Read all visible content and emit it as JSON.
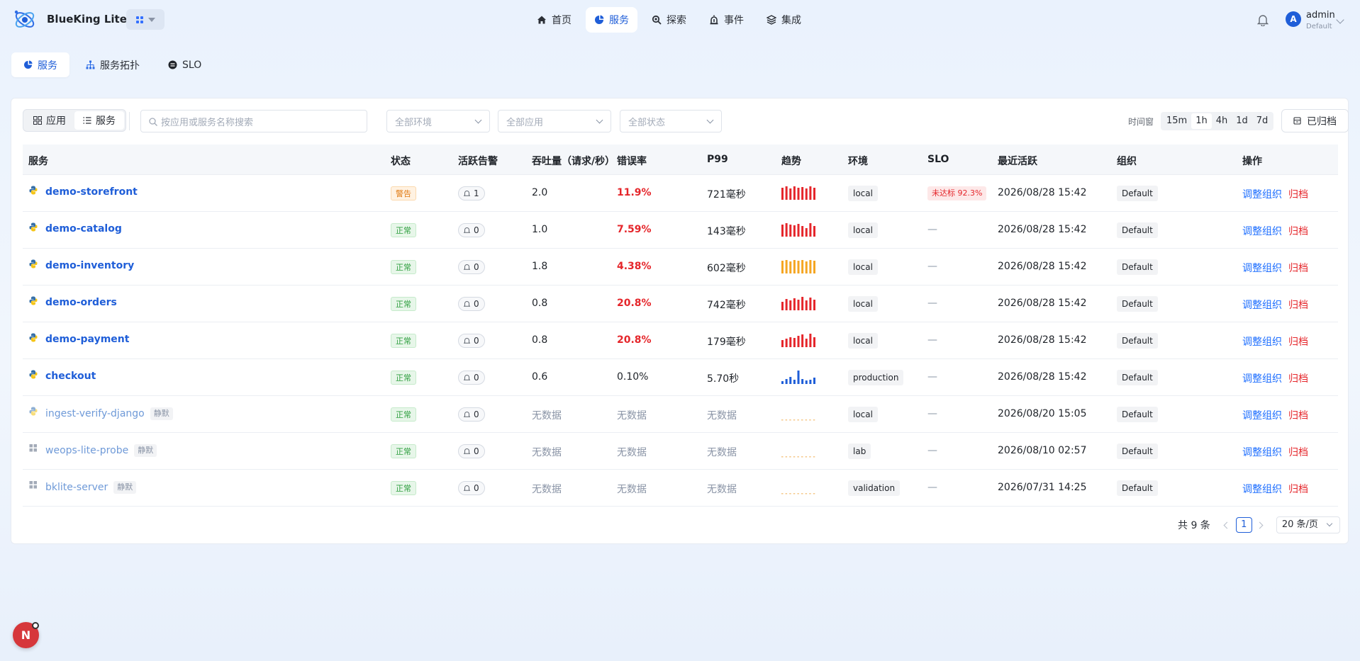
{
  "app": {
    "brand": "BlueKing Lite",
    "workspace_icon": "grid-icon"
  },
  "nav": [
    {
      "label": "首页",
      "icon": "home-icon",
      "active": false
    },
    {
      "label": "服务",
      "icon": "service-icon",
      "active": true
    },
    {
      "label": "探索",
      "icon": "explore-icon",
      "active": false
    },
    {
      "label": "事件",
      "icon": "alarm-icon",
      "active": false
    },
    {
      "label": "集成",
      "icon": "layers-icon",
      "active": false
    }
  ],
  "user": {
    "initial": "A",
    "name": "admin",
    "org": "Default"
  },
  "subtabs": [
    {
      "label": "服务",
      "active": true
    },
    {
      "label": "服务拓扑",
      "active": false
    },
    {
      "label": "SLO",
      "active": false
    }
  ],
  "toolbar": {
    "view_app": "应用",
    "view_service": "服务",
    "search_placeholder": "按应用或服务名称搜索",
    "filter_env": "全部环境",
    "filter_app": "全部应用",
    "filter_status": "全部状态",
    "time_label": "时间窗",
    "time_options": [
      "15m",
      "1h",
      "4h",
      "1d",
      "7d"
    ],
    "time_selected": "1h",
    "archived_label": "已归档"
  },
  "table": {
    "columns": {
      "service": "服务",
      "status": "状态",
      "alerts": "活跃告警",
      "throughput": "吞吐量（请求/秒）",
      "error_rate": "错误率",
      "p99": "P99",
      "trend": "趋势",
      "env": "环境",
      "slo": "SLO",
      "last_active": "最近活跃",
      "org": "组织",
      "ops": "操作"
    },
    "muted_label": "静默",
    "action_adjust": "调整组织",
    "action_archive": "归档",
    "no_slo": "—",
    "rows": [
      {
        "name": "demo-storefront",
        "lang": "python",
        "muted": false,
        "status": "警告",
        "status_type": "warn",
        "alerts": "1",
        "throughput": "2.0",
        "error_rate": "11.9%",
        "error_high": true,
        "p99": "721毫秒",
        "trend_color": "#e5262b",
        "trend": [
          0.85,
          0.95,
          0.8,
          0.95,
          0.85,
          0.9,
          0.8,
          0.95,
          0.85
        ],
        "env": "local",
        "slo": "未达标 92.3%",
        "last_active": "2026/08/28 15:42",
        "org": "Default"
      },
      {
        "name": "demo-catalog",
        "lang": "python",
        "muted": false,
        "status": "正常",
        "status_type": "ok",
        "alerts": "0",
        "throughput": "1.0",
        "error_rate": "7.59%",
        "error_high": true,
        "p99": "143毫秒",
        "trend_color": "#e5262b",
        "trend": [
          0.85,
          0.95,
          0.85,
          0.8,
          0.9,
          0.75,
          0.6,
          0.95,
          0.75
        ],
        "env": "local",
        "slo": "",
        "last_active": "2026/08/28 15:42",
        "org": "Default"
      },
      {
        "name": "demo-inventory",
        "lang": "python",
        "muted": false,
        "status": "正常",
        "status_type": "ok",
        "alerts": "0",
        "throughput": "1.8",
        "error_rate": "4.38%",
        "error_high": true,
        "p99": "602毫秒",
        "trend_color": "#f5a623",
        "trend": [
          0.9,
          0.95,
          0.85,
          0.95,
          0.9,
          0.95,
          0.85,
          0.95,
          0.9
        ],
        "env": "local",
        "slo": "",
        "last_active": "2026/08/28 15:42",
        "org": "Default"
      },
      {
        "name": "demo-orders",
        "lang": "python",
        "muted": false,
        "status": "正常",
        "status_type": "ok",
        "alerts": "0",
        "throughput": "0.8",
        "error_rate": "20.8%",
        "error_high": true,
        "p99": "742毫秒",
        "trend_color": "#e5262b",
        "trend": [
          0.6,
          0.8,
          0.7,
          0.85,
          0.75,
          0.95,
          0.7,
          0.9,
          0.75
        ],
        "env": "local",
        "slo": "",
        "last_active": "2026/08/28 15:42",
        "org": "Default"
      },
      {
        "name": "demo-payment",
        "lang": "python",
        "muted": false,
        "status": "正常",
        "status_type": "ok",
        "alerts": "0",
        "throughput": "0.8",
        "error_rate": "20.8%",
        "error_high": true,
        "p99": "179毫秒",
        "trend_color": "#e5262b",
        "trend": [
          0.5,
          0.6,
          0.7,
          0.65,
          0.8,
          0.9,
          0.6,
          0.95,
          0.7
        ],
        "env": "local",
        "slo": "",
        "last_active": "2026/08/28 15:42",
        "org": "Default"
      },
      {
        "name": "checkout",
        "lang": "python",
        "muted": false,
        "status": "正常",
        "status_type": "ok",
        "alerts": "0",
        "throughput": "0.6",
        "error_rate": "0.10%",
        "error_high": false,
        "p99": "5.70秒",
        "trend_color": "#1f5ed8",
        "trend": [
          0.2,
          0.35,
          0.5,
          0.3,
          0.95,
          0.35,
          0.25,
          0.3,
          0.45
        ],
        "env": "production",
        "slo": "",
        "last_active": "2026/08/28 15:42",
        "org": "Default"
      },
      {
        "name": "ingest-verify-django",
        "lang": "python",
        "muted": true,
        "status": "正常",
        "status_type": "ok",
        "alerts": "0",
        "throughput": "无数据",
        "error_rate": "无数据",
        "error_high": false,
        "p99": "无数据",
        "trend_color": "",
        "trend": [],
        "env": "local",
        "slo": "",
        "last_active": "2026/08/20 15:05",
        "org": "Default"
      },
      {
        "name": "weops-lite-probe",
        "lang": "generic",
        "muted": true,
        "status": "正常",
        "status_type": "ok",
        "alerts": "0",
        "throughput": "无数据",
        "error_rate": "无数据",
        "error_high": false,
        "p99": "无数据",
        "trend_color": "",
        "trend": [],
        "env": "lab",
        "slo": "",
        "last_active": "2026/08/10 02:57",
        "org": "Default"
      },
      {
        "name": "bklite-server",
        "lang": "generic",
        "muted": true,
        "status": "正常",
        "status_type": "ok",
        "alerts": "0",
        "throughput": "无数据",
        "error_rate": "无数据",
        "error_high": false,
        "p99": "无数据",
        "trend_color": "",
        "trend": [],
        "env": "validation",
        "slo": "",
        "last_active": "2026/07/31 14:25",
        "org": "Default"
      }
    ]
  },
  "pagination": {
    "total": "共 9 条",
    "current": "1",
    "page_size": "20 条/页"
  },
  "fab": {
    "letter": "N"
  }
}
